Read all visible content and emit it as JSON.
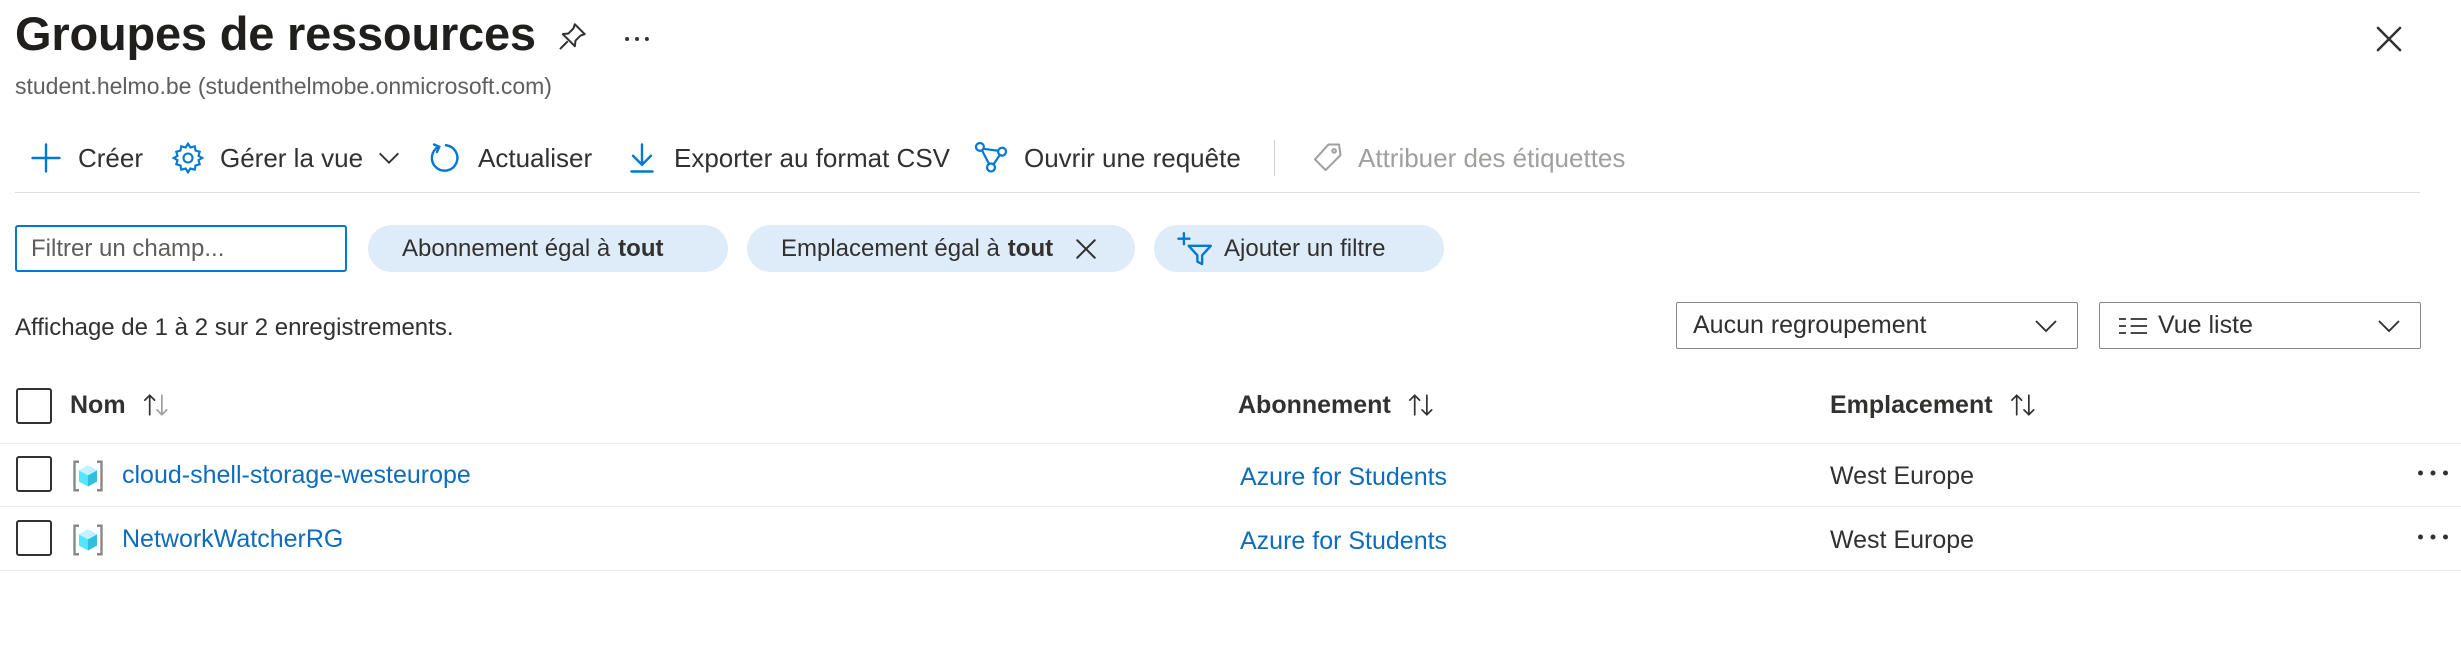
{
  "page": {
    "title": "Groupes de ressources",
    "subtitle": "student.helmo.be (studenthelmobe.onmicrosoft.com)"
  },
  "toolbar": {
    "create": "Créer",
    "manage_view": "Gérer la vue",
    "refresh": "Actualiser",
    "export_csv": "Exporter au format CSV",
    "open_query": "Ouvrir une requête",
    "assign_tags": "Attribuer des étiquettes"
  },
  "filters": {
    "input_placeholder": "Filtrer un champ...",
    "subscription_prefix": "Abonnement égal à",
    "subscription_value": "tout",
    "location_prefix": "Emplacement égal à",
    "location_value": "tout",
    "add_filter": "Ajouter un filtre"
  },
  "records_text": "Affichage de 1 à 2 sur 2 enregistrements.",
  "grouping": {
    "selected": "Aucun regroupement"
  },
  "view": {
    "selected": "Vue liste"
  },
  "table": {
    "columns": {
      "name": "Nom",
      "subscription": "Abonnement",
      "location": "Emplacement"
    },
    "rows": [
      {
        "name": "cloud-shell-storage-westeurope",
        "subscription": "Azure for Students",
        "location": "West Europe"
      },
      {
        "name": "NetworkWatcherRG",
        "subscription": "Azure for Students",
        "location": "West Europe"
      }
    ]
  },
  "colors": {
    "accent": "#0078d4",
    "link": "#0f6cbd",
    "pill_bg": "#deecf9"
  }
}
